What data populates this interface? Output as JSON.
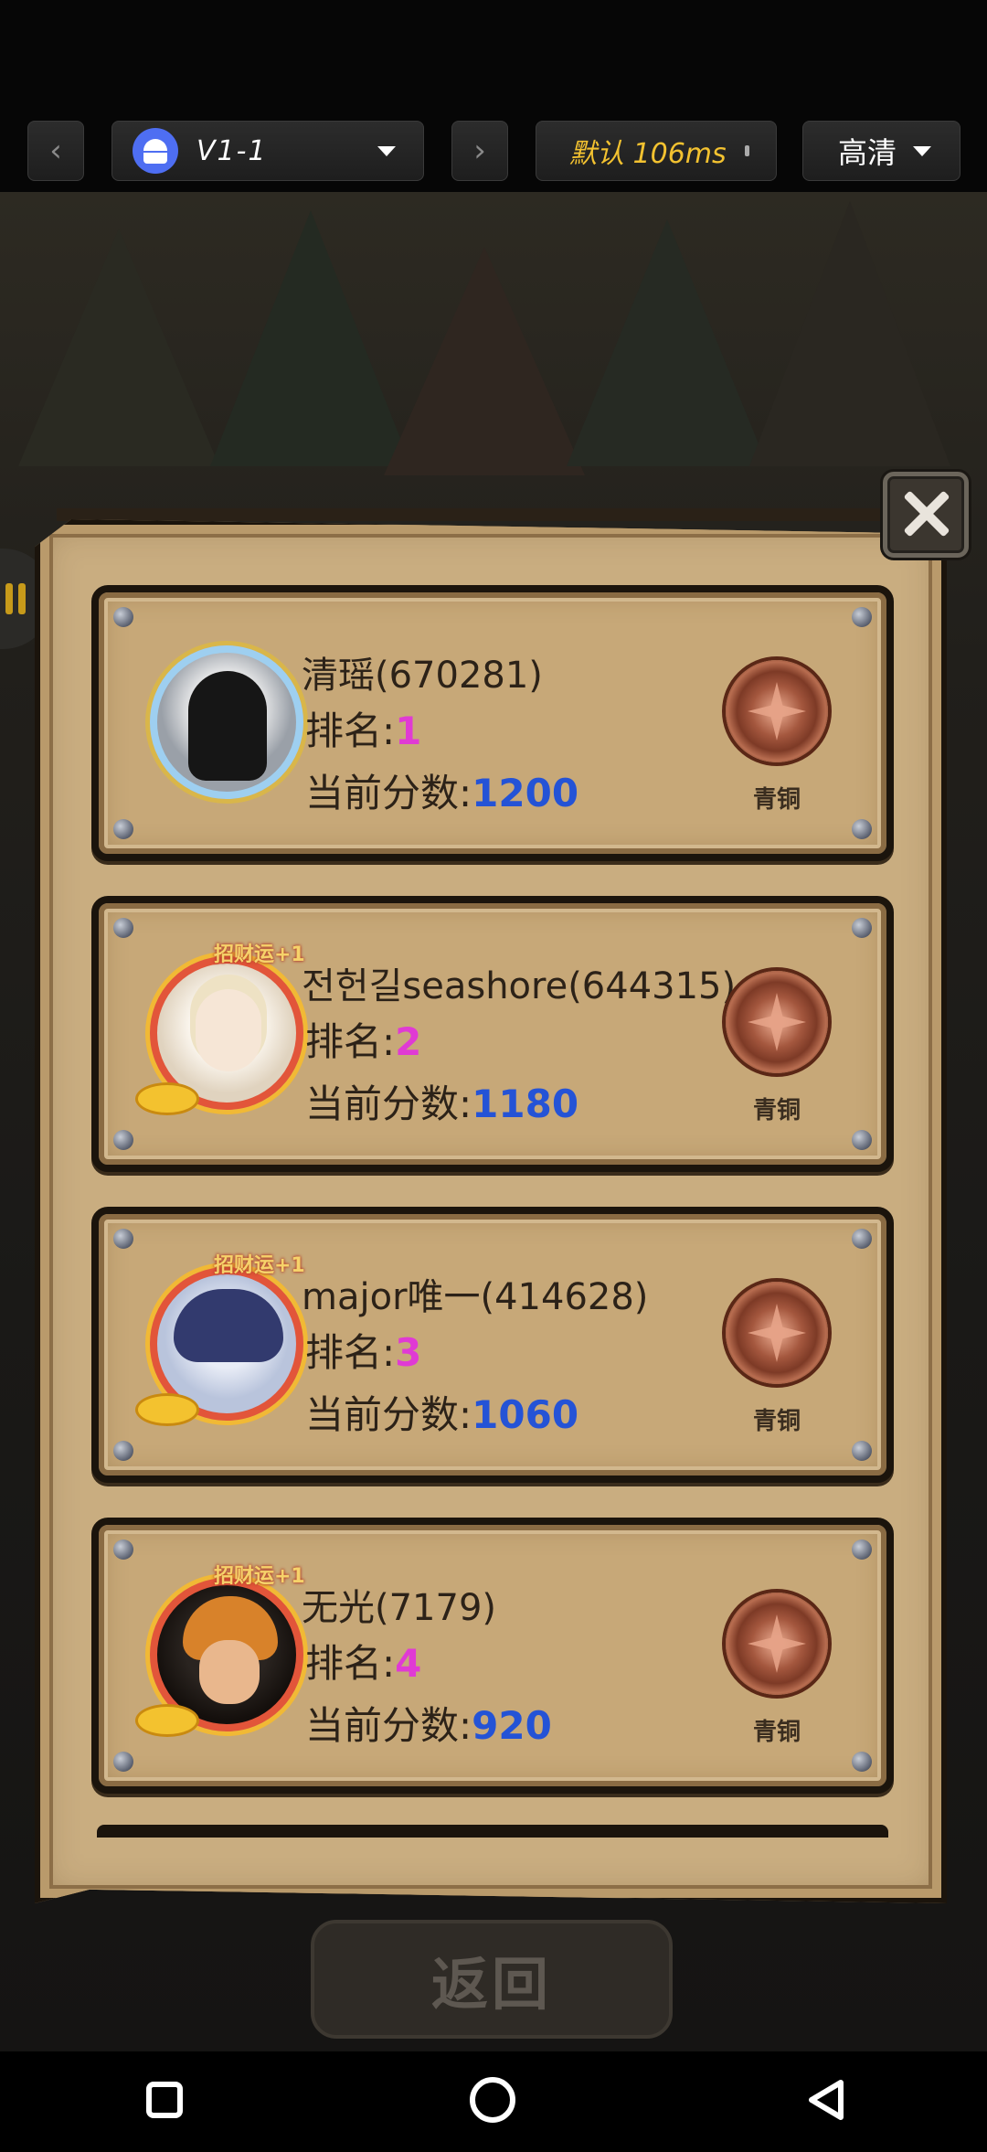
{
  "toolbar": {
    "device_label": "V1-1",
    "latency_label": "默认 106ms",
    "quality_label": "高清",
    "android_icon": "android-icon",
    "back_icon": "chevron-left-icon",
    "forward_icon": "chevron-right-icon"
  },
  "leaderboard": {
    "rank_prefix": "排名:",
    "score_prefix": "当前分数:",
    "entries": [
      {
        "name": "清瑶(670281)",
        "rank": "1",
        "score": "1200",
        "tier": "青铜",
        "charm": ""
      },
      {
        "name": "전헌길seashore(644315)",
        "rank": "2",
        "score": "1180",
        "tier": "青铜",
        "charm": "招财运+1"
      },
      {
        "name": "major唯一(414628)",
        "rank": "3",
        "score": "1060",
        "tier": "青铜",
        "charm": "招财运+1"
      },
      {
        "name": "无光(7179)",
        "rank": "4",
        "score": "920",
        "tier": "青铜",
        "charm": "招财运+1"
      }
    ]
  },
  "return_label": "返回",
  "colors": {
    "rank_value": "#e03ad4",
    "score_value": "#2453d6",
    "latency_text": "#f3c230"
  }
}
